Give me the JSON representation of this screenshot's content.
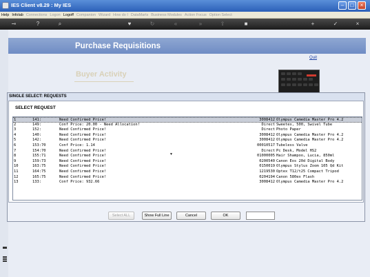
{
  "window": {
    "title": "IES Client v8.29 : My IES"
  },
  "menu": {
    "items": [
      {
        "label": "Help",
        "enabled": true
      },
      {
        "label": "Infolab",
        "enabled": true
      },
      {
        "label": "Connections",
        "enabled": false
      },
      {
        "label": "Logon",
        "enabled": false
      },
      {
        "label": "Logoff",
        "enabled": true
      },
      {
        "label": "Companion",
        "enabled": false
      },
      {
        "label": "Wizard",
        "enabled": false
      },
      {
        "label": "How do I",
        "enabled": false
      },
      {
        "label": "DataMarts",
        "enabled": false
      },
      {
        "label": "Business Modules",
        "enabled": false
      },
      {
        "label": "Action Focus",
        "enabled": false
      },
      {
        "label": "Option Select",
        "enabled": false
      }
    ]
  },
  "toolbar": {
    "icons": [
      "key-icon",
      "help-icon",
      "search-icon",
      "heart-icon",
      "refresh-icon",
      "rewind-icon",
      "forward-icon",
      "upload-icon",
      "stop-icon",
      "plus-icon",
      "check-icon",
      "close-icon"
    ]
  },
  "page": {
    "banner_title": "Purchase Requisitions",
    "quit_label": "Quit",
    "section_title": "Buyer Activity"
  },
  "dialog": {
    "title": "SINGLE SELECT: REQUESTS",
    "heading": "SELECT REQUEST",
    "rows": [
      {
        "num": "1",
        "id": "141:",
        "desc": "Need Confirmed Price!",
        "code": "3008412",
        "item": "Olympus Camedia Master Pro 4.2"
      },
      {
        "num": "2",
        "id": "149:",
        "desc": "Conf Price: 20.00 - Need Allocation!",
        "code": "Direct",
        "item": "Sweetex, 500, Swivel Tube"
      },
      {
        "num": "3",
        "id": "152:",
        "desc": "Need Confirmed Price!",
        "code": "Direct",
        "item": "Photo Paper"
      },
      {
        "num": "4",
        "id": "140:",
        "desc": "Need Confirmed Price!",
        "code": "3008412",
        "item": "Olympus Camedia Master Pro 4.2"
      },
      {
        "num": "5",
        "id": "142:",
        "desc": "Need Confirmed Price!",
        "code": "3008412",
        "item": "Olympus Camedia Master Pro 4.2"
      },
      {
        "num": "6",
        "id": "153:70",
        "desc": "Conf Price: 1.14",
        "code": "00010517",
        "item": "Tubeless Valve"
      },
      {
        "num": "7",
        "id": "154:70",
        "desc": "Need Confirmed Price!",
        "code": "Direct",
        "item": "Pc Desk, Model HS2"
      },
      {
        "num": "8",
        "id": "155:71",
        "desc": "Need Confirmed Price!",
        "code": "01000005",
        "item": "Hair Shampoo, Lucia, 850ml"
      },
      {
        "num": "9",
        "id": "159:73",
        "desc": "Need Confirmed Price!",
        "code": "0200540",
        "item": "Canon Eos 20d Digital Body"
      },
      {
        "num": "10",
        "id": "163:75",
        "desc": "Need Confirmed Price!",
        "code": "0150019",
        "item": "Olympus Stylus Zoom 105 Qd Kit"
      },
      {
        "num": "11",
        "id": "164:75",
        "desc": "Need Confirmed Price!",
        "code": "1219530",
        "item": "Optex T12/t25 Compact Tripod"
      },
      {
        "num": "12",
        "id": "165:75",
        "desc": "Need Confirmed Price!",
        "code": "0204194",
        "item": "Canon 580ex Flash"
      },
      {
        "num": "13",
        "id": "133:",
        "desc": "Conf Price: 932.66",
        "code": "3008412",
        "item": "Olympus Camedia Master Pro 4.2"
      }
    ],
    "buttons": {
      "select_all": "Select ALL",
      "show_full_line": "Show Full Line",
      "cancel": "Cancel",
      "ok": "OK"
    },
    "input_value": ""
  },
  "colors": {
    "banner": "#7f99cc",
    "toolbar": "#2a2a2a",
    "titlebar": "#3a6cc4",
    "selected_row": "#c9ced8"
  }
}
